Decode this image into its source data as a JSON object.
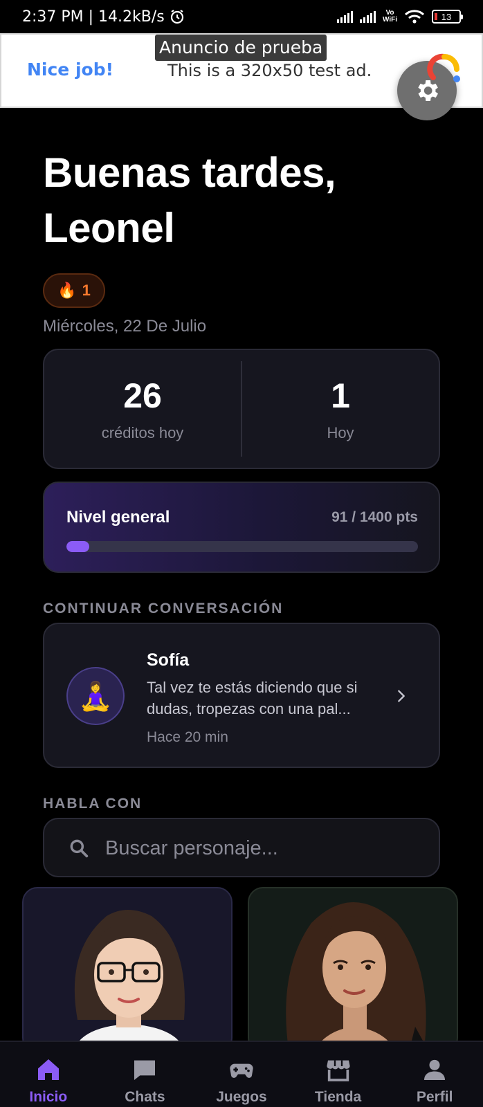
{
  "status_bar": {
    "left_text": "2:37 PM | 14.2kB/s",
    "alarm_icon": "alarm-clock-icon",
    "vowifi_top": "Vo",
    "vowifi_bottom": "WiFi",
    "battery_level": "13"
  },
  "ad": {
    "label": "Anuncio de prueba",
    "nice": "Nice job!",
    "text": "This is a 320x50 test ad.",
    "settings_icon": "gear-icon"
  },
  "greeting": {
    "line1": "Buenas tardes,",
    "line2": "Leonel"
  },
  "streak": {
    "icon": "🔥",
    "count": "1"
  },
  "date": "Miércoles, 22 De Julio",
  "stats": [
    {
      "value": "26",
      "label": "créditos hoy"
    },
    {
      "value": "1",
      "label": "Hoy"
    }
  ],
  "level": {
    "title": "Nivel general",
    "points": "91 / 1400 pts",
    "progress": 0.065,
    "accent": "#8b5cf6"
  },
  "continue_section": {
    "title": "CONTINUAR CONVERSACIÓN",
    "conversation": {
      "avatar_emoji": "🧘‍♀️",
      "name": "Sofía",
      "message": "Tal vez te estás diciendo que si dudas, tropezas con una pal...",
      "time": "Hace 20 min"
    }
  },
  "talk_section": {
    "title": "HABLA CON",
    "search_placeholder": "Buscar personaje..."
  },
  "characters": [
    {
      "portrait": "woman-with-glasses-portrait"
    },
    {
      "portrait": "woman-with-wavy-hair-portrait"
    }
  ],
  "bottom_nav": [
    {
      "label": "Inicio",
      "icon": "home-icon",
      "active": true
    },
    {
      "label": "Chats",
      "icon": "chat-icon",
      "active": false
    },
    {
      "label": "Juegos",
      "icon": "gamepad-icon",
      "active": false
    },
    {
      "label": "Tienda",
      "icon": "store-icon",
      "active": false
    },
    {
      "label": "Perfil",
      "icon": "person-icon",
      "active": false
    }
  ]
}
